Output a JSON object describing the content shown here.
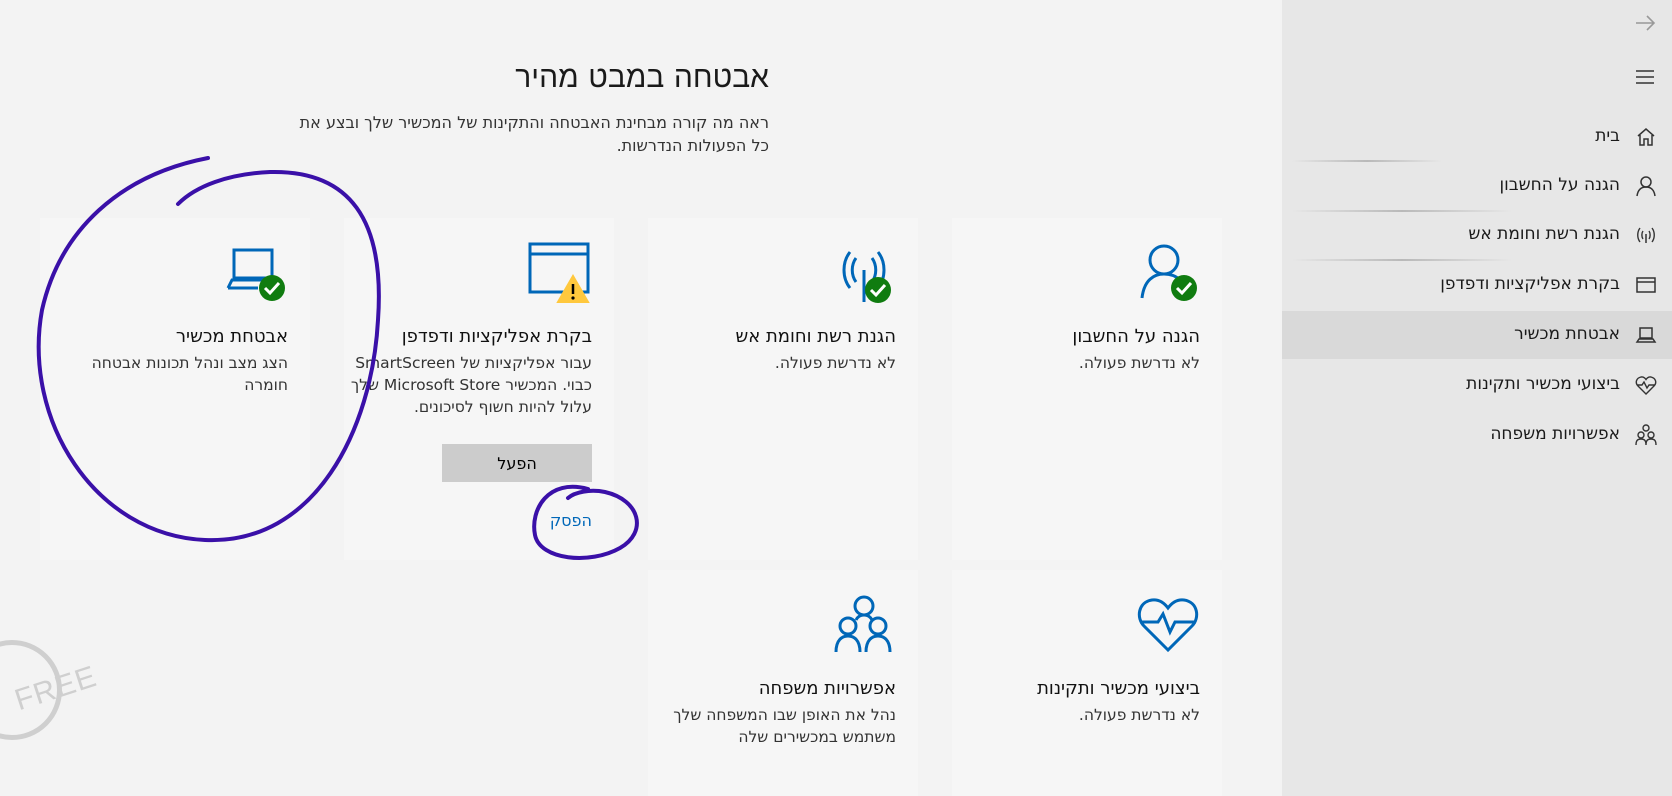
{
  "sidebar": {
    "items": [
      {
        "label": "בית",
        "icon": "home-icon"
      },
      {
        "label": "הגנה על החשבון",
        "icon": "person-icon"
      },
      {
        "label": "הגנת רשת וחומת אש",
        "icon": "antenna-icon"
      },
      {
        "label": "בקרת אפליקציות ודפדפן",
        "icon": "browser-window-icon"
      },
      {
        "label": "אבטחת מכשיר",
        "icon": "laptop-icon",
        "selected": true
      },
      {
        "label": "ביצועי מכשיר ותקינות",
        "icon": "heart-icon"
      },
      {
        "label": "אפשרויות משפחה",
        "icon": "family-icon"
      }
    ]
  },
  "page": {
    "title": "אבטחה במבט מהיר",
    "subtitle": "ראה מה קורה מבחינת האבטחה והתקינות של המכשיר שלך ובצע את כל הפעולות הנדרשות."
  },
  "cards": {
    "account": {
      "title": "הגנה על החשבון",
      "desc": "לא נדרשת פעולה."
    },
    "network": {
      "title": "הגנת רשת וחומת אש",
      "desc": "לא נדרשת פעולה."
    },
    "apps": {
      "title": "בקרת אפליקציות ודפדפן",
      "desc": "עבור אפליקציות של SmartScreen כבוי. המכשיר Microsoft Store שלך עלול להיות חשוף לסיכונים.",
      "button": "הפעל",
      "link": "הפסק"
    },
    "device": {
      "title": "אבטחת מכשיר",
      "desc": "הצג מצב ונהל תכונות אבטחה חומרה"
    },
    "health": {
      "title": "ביצועי מכשיר ותקינות",
      "desc": "לא נדרשת פעולה."
    },
    "family": {
      "title": "אפשרויות משפחה",
      "desc": "נהל את האופן שבו המשפחה שלך משתמש במכשירים שלה"
    }
  },
  "watermark": {
    "text": "FREE"
  },
  "colors": {
    "accent": "#0067b8",
    "ok": "#107c10",
    "warn": "#ffc83d",
    "annotation": "#3a10a8"
  }
}
